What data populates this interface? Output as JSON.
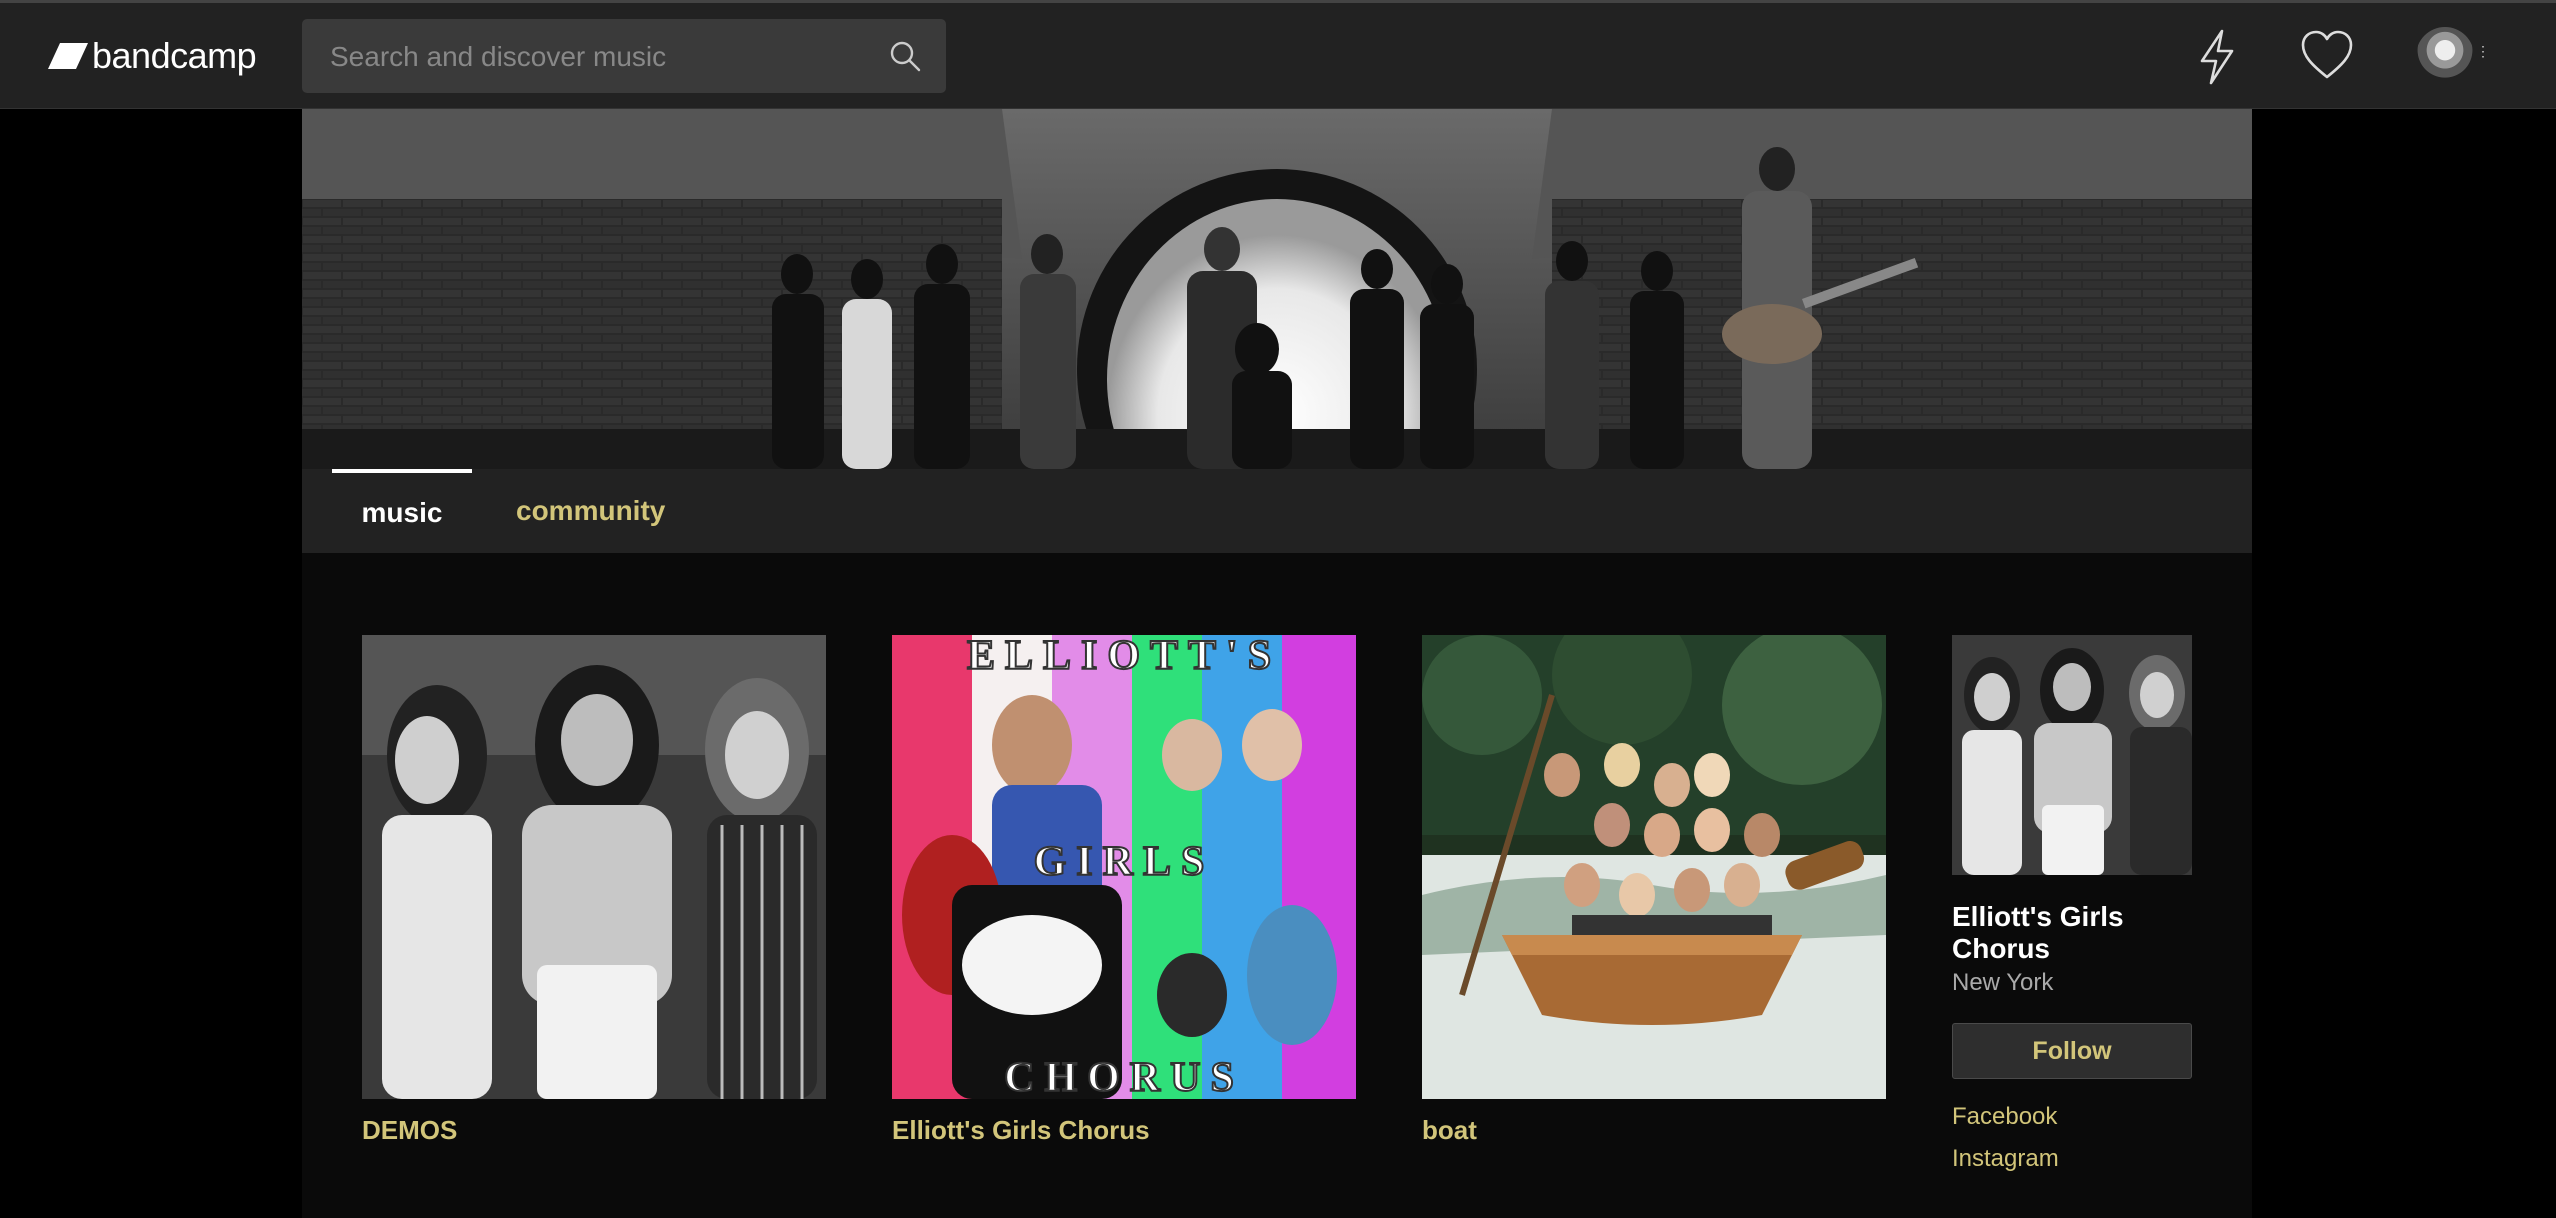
{
  "header": {
    "brand": "bandcamp",
    "search": {
      "placeholder": "Search and discover music",
      "value": ""
    },
    "icons": [
      "bolt-icon",
      "heart-icon",
      "avatar"
    ]
  },
  "tabs": [
    {
      "label": "music",
      "active": true
    },
    {
      "label": "community",
      "active": false
    }
  ],
  "albums": [
    {
      "title": "DEMOS"
    },
    {
      "title": "Elliott's Girls Chorus",
      "cover_text_top": "ELLIOTT'S",
      "cover_text_mid": "GIRLS",
      "cover_text_bottom": "CHORUS"
    },
    {
      "title": "boat"
    }
  ],
  "profile": {
    "name": "Elliott's Girls Chorus",
    "location": "New York",
    "follow_label": "Follow",
    "links": [
      "Facebook",
      "Instagram"
    ]
  },
  "colors": {
    "accent": "#d2c57a",
    "topbar": "#222222",
    "background": "#000000"
  }
}
